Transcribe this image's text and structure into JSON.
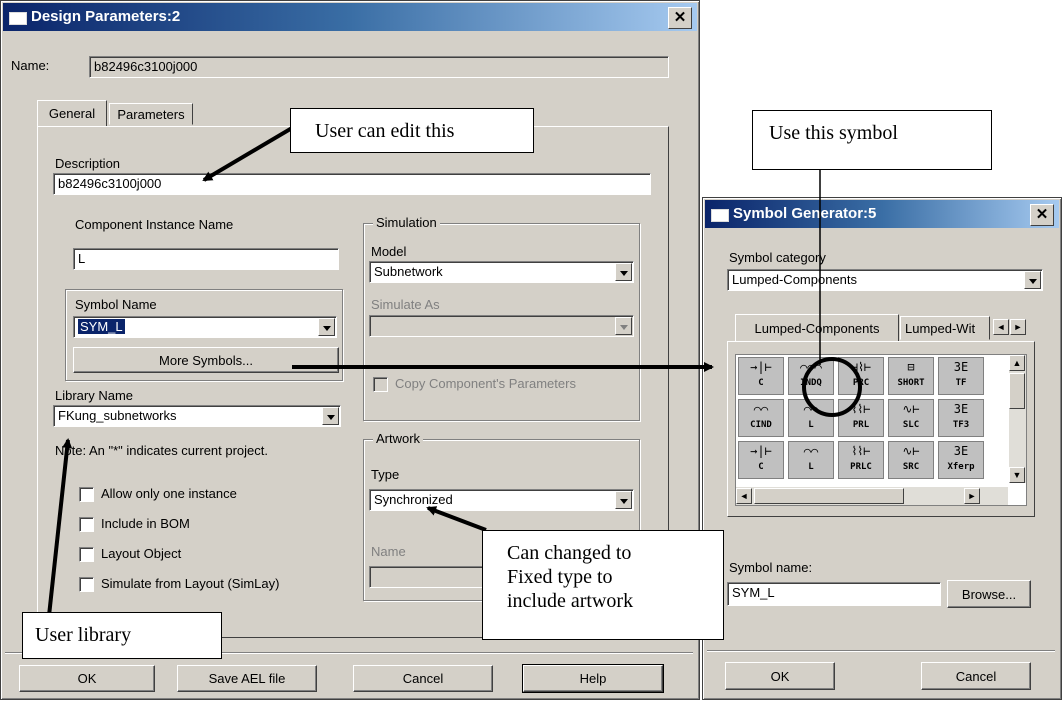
{
  "design_dialog": {
    "title": "Design Parameters:2",
    "name_label": "Name:",
    "name_value": "b82496c3100j000",
    "tabs": [
      "General",
      "Parameters"
    ],
    "description_label": "Description",
    "description_value": "b82496c3100j000",
    "component_instance_label": "Component Instance Name",
    "component_instance_value": "L",
    "symbol_name_group": "Symbol Name",
    "symbol_name_value": "SYM_L",
    "more_symbols_label": "More Symbols...",
    "library_name_label": "Library Name",
    "library_name_value": "FKung_subnetworks",
    "note_text": "Note: An \"*\" indicates current project.",
    "checkboxes": [
      "Allow only one instance",
      "Include in BOM",
      "Layout Object",
      "Simulate from Layout (SimLay)"
    ],
    "simulation_group": "Simulation",
    "model_label": "Model",
    "model_value": "Subnetwork",
    "simulate_as_label": "Simulate As",
    "simulate_as_value": "",
    "copy_params_label": "Copy Component's Parameters",
    "artwork_group": "Artwork",
    "type_label": "Type",
    "type_value": "Synchronized",
    "artwork_name_label": "Name",
    "buttons": {
      "ok": "OK",
      "save_ael": "Save AEL file",
      "cancel": "Cancel",
      "help": "Help"
    }
  },
  "symbol_dialog": {
    "title": "Symbol Generator:5",
    "category_label": "Symbol category",
    "category_value": "Lumped-Components",
    "tabs": [
      "Lumped-Components",
      "Lumped-Wit"
    ],
    "symbols": [
      {
        "glyph": "→|⊢",
        "name": "C"
      },
      {
        "glyph": "⌒⌒⌒",
        "name": "INDQ"
      },
      {
        "glyph": "⊣⌇⊢",
        "name": "PRC"
      },
      {
        "glyph": "⊟",
        "name": "SHORT"
      },
      {
        "glyph": "3E",
        "name": "TF"
      },
      {
        "glyph": "⌒⌒",
        "name": "CIND"
      },
      {
        "glyph": "⌒⌒",
        "name": "L"
      },
      {
        "glyph": "⌇⌇⊢",
        "name": "PRL"
      },
      {
        "glyph": "∿⊢",
        "name": "SLC"
      },
      {
        "glyph": "3E",
        "name": "TF3"
      },
      {
        "glyph": "→|⊢",
        "name": "C"
      },
      {
        "glyph": "⌒⌒",
        "name": "L"
      },
      {
        "glyph": "⌇⌇⊢",
        "name": "PRLC"
      },
      {
        "glyph": "∿⊢",
        "name": "SRC"
      },
      {
        "glyph": "3E",
        "name": "Xferp"
      }
    ],
    "symbol_name_label": "Symbol name:",
    "symbol_name_value": "SYM_L",
    "browse_label": "Browse...",
    "ok_label": "OK",
    "cancel_label": "Cancel"
  },
  "annotations": {
    "user_can_edit": "User can edit this",
    "use_symbol": "Use this symbol",
    "can_change": [
      "Can changed to",
      "Fixed type to",
      "include artwork"
    ],
    "user_library": "User library"
  }
}
